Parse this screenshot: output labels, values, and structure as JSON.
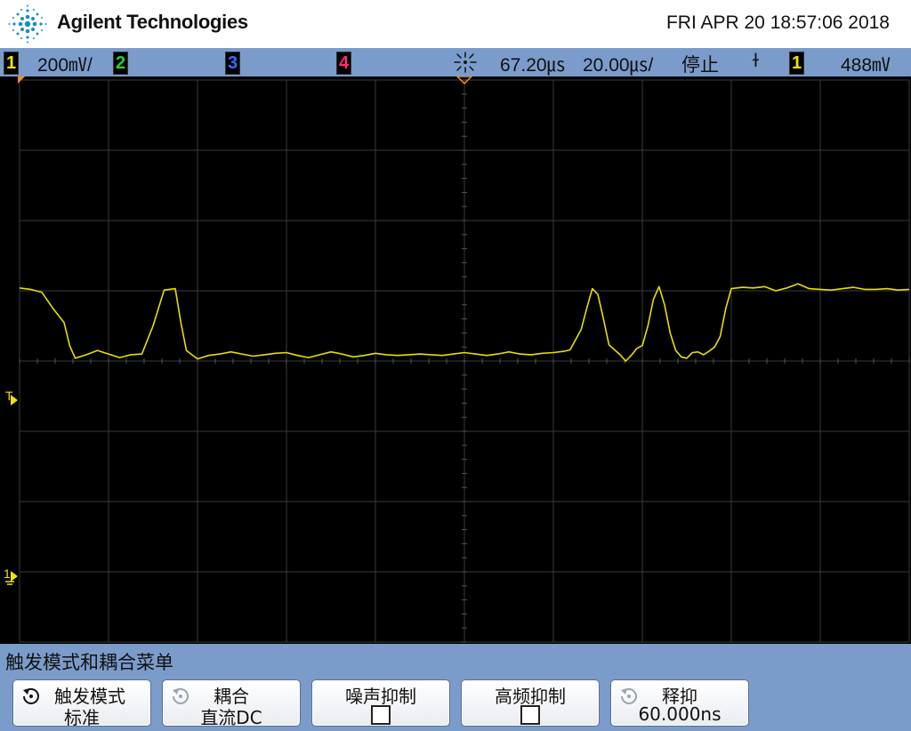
{
  "header": {
    "brand": "Agilent Technologies",
    "datetime": "FRI APR 20 18:57:06 2018"
  },
  "status_bar": {
    "ch1": {
      "num": "1",
      "scale": "200㎷/",
      "color": "#f2e600"
    },
    "ch2": {
      "num": "2",
      "color": "#2bd12b"
    },
    "ch3": {
      "num": "3",
      "color": "#3b6cff"
    },
    "ch4": {
      "num": "4",
      "color": "#ff2d6e"
    },
    "delay": "67.20㎲",
    "timebase": "20.00㎲/",
    "run_state": "停止",
    "trigger_slope": "ɫ",
    "trigger_source": "1",
    "trigger_level": "488㎷",
    "accent": "#7b9ccb"
  },
  "screen": {
    "trigger_marker": "T",
    "ground_marker": "1",
    "trace_color": "#e6e000",
    "grid_color": "#3a3a3a"
  },
  "chart_data": {
    "type": "line",
    "series": [
      {
        "values": [
          [
            0,
            50.4
          ],
          [
            2,
            50.2
          ],
          [
            4,
            49.8
          ],
          [
            6,
            47.5
          ],
          [
            8,
            45.5
          ],
          [
            9,
            42.2
          ],
          [
            10,
            40.4
          ],
          [
            12,
            40.9
          ],
          [
            14,
            41.5
          ],
          [
            16,
            41.0
          ],
          [
            18,
            40.5
          ],
          [
            20,
            40.9
          ],
          [
            22,
            41.0
          ],
          [
            24,
            45.0
          ],
          [
            26,
            50.1
          ],
          [
            28,
            50.3
          ],
          [
            29,
            45.5
          ],
          [
            30,
            41.5
          ],
          [
            32,
            40.3
          ],
          [
            34,
            40.8
          ],
          [
            36,
            41.0
          ],
          [
            38,
            41.3
          ],
          [
            40,
            41.0
          ],
          [
            42,
            40.7
          ],
          [
            44,
            40.9
          ],
          [
            46,
            41.1
          ],
          [
            48,
            41.2
          ],
          [
            50,
            40.8
          ],
          [
            52,
            40.5
          ],
          [
            54,
            40.9
          ],
          [
            56,
            41.3
          ],
          [
            58,
            41.0
          ],
          [
            60,
            40.6
          ],
          [
            62,
            40.8
          ],
          [
            64,
            41.1
          ],
          [
            66,
            40.9
          ],
          [
            68,
            40.8
          ],
          [
            70,
            40.9
          ],
          [
            72,
            41.0
          ],
          [
            74,
            40.9
          ],
          [
            76,
            40.8
          ],
          [
            78,
            41.0
          ],
          [
            80,
            41.2
          ],
          [
            82,
            41.0
          ],
          [
            84,
            40.8
          ],
          [
            86,
            41.0
          ],
          [
            88,
            41.3
          ],
          [
            90,
            41.0
          ],
          [
            92,
            40.9
          ],
          [
            94,
            41.1
          ],
          [
            96,
            41.2
          ],
          [
            98,
            41.4
          ],
          [
            99,
            41.6
          ],
          [
            101,
            44.5
          ],
          [
            102,
            47.5
          ],
          [
            103,
            50.3
          ],
          [
            104,
            49.5
          ],
          [
            105,
            46.0
          ],
          [
            106,
            42.3
          ],
          [
            108,
            40.9
          ],
          [
            109,
            40.0
          ],
          [
            110,
            40.8
          ],
          [
            111,
            41.8
          ],
          [
            112,
            42.2
          ],
          [
            113,
            45.0
          ],
          [
            114,
            48.8
          ],
          [
            115,
            50.6
          ],
          [
            116,
            48.0
          ],
          [
            117,
            44.0
          ],
          [
            118,
            41.5
          ],
          [
            119,
            40.6
          ],
          [
            120,
            40.4
          ],
          [
            121,
            41.2
          ],
          [
            122,
            41.3
          ],
          [
            123,
            40.9
          ],
          [
            124,
            41.4
          ],
          [
            125,
            42.0
          ],
          [
            126,
            43.5
          ],
          [
            127,
            47.5
          ],
          [
            128,
            50.3
          ],
          [
            130,
            50.5
          ],
          [
            132,
            50.4
          ],
          [
            134,
            50.6
          ],
          [
            136,
            50.0
          ],
          [
            138,
            50.4
          ],
          [
            140,
            51.0
          ],
          [
            142,
            50.3
          ],
          [
            144,
            50.2
          ],
          [
            146,
            50.1
          ],
          [
            148,
            50.3
          ],
          [
            150,
            50.5
          ],
          [
            152,
            50.2
          ],
          [
            154,
            50.2
          ],
          [
            156,
            50.3
          ],
          [
            158,
            50.1
          ],
          [
            160,
            50.2
          ]
        ]
      }
    ],
    "xlim": [
      0,
      160
    ],
    "ylim": [
      0,
      80
    ],
    "grid": true,
    "divisions": {
      "x": 10,
      "y": 8
    }
  },
  "menu": {
    "title": "触发模式和耦合菜单",
    "softkeys": [
      {
        "label": "触发模式",
        "value": "标准",
        "icon": "rotate-knob-icon"
      },
      {
        "label": "耦合",
        "value": "直流DC",
        "icon": "rotate-knob-icon"
      },
      {
        "label": "噪声抑制",
        "value": "",
        "icon": "checkbox-icon"
      },
      {
        "label": "高频抑制",
        "value": "",
        "icon": "checkbox-icon"
      },
      {
        "label": "释抑",
        "value": "60.000ns",
        "icon": "rotate-knob-icon"
      }
    ]
  }
}
